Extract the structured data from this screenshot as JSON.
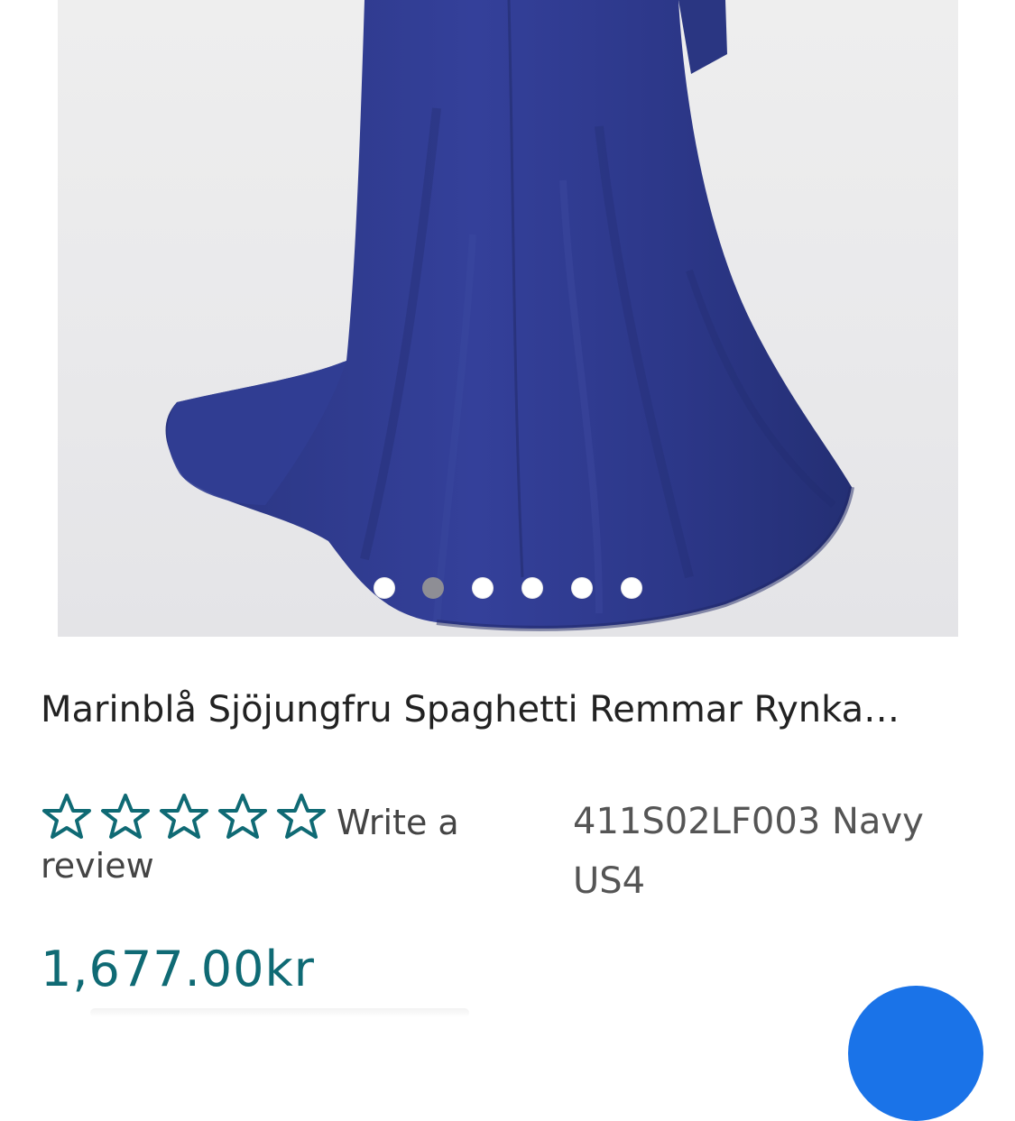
{
  "gallery": {
    "image_alt": "navy mermaid dress",
    "dot_count": 6,
    "active_dot_index": 1,
    "fabric_color": "#2c3a86",
    "background_color": "#ebebed"
  },
  "product": {
    "title": "Marinblå Sjöjungfru Spaghetti Remmar Rynka…",
    "review_line1": "Write a",
    "review_line2": "review",
    "sku_line1": "411S02LF003 Navy",
    "sku_line2": "US4",
    "price": "1,677.00kr",
    "rating": 0,
    "rating_max": 5
  },
  "colors": {
    "accent": "#0f6a74",
    "fab": "#1a73e8"
  },
  "icons": {
    "rating_star": "star-outline-icon"
  }
}
